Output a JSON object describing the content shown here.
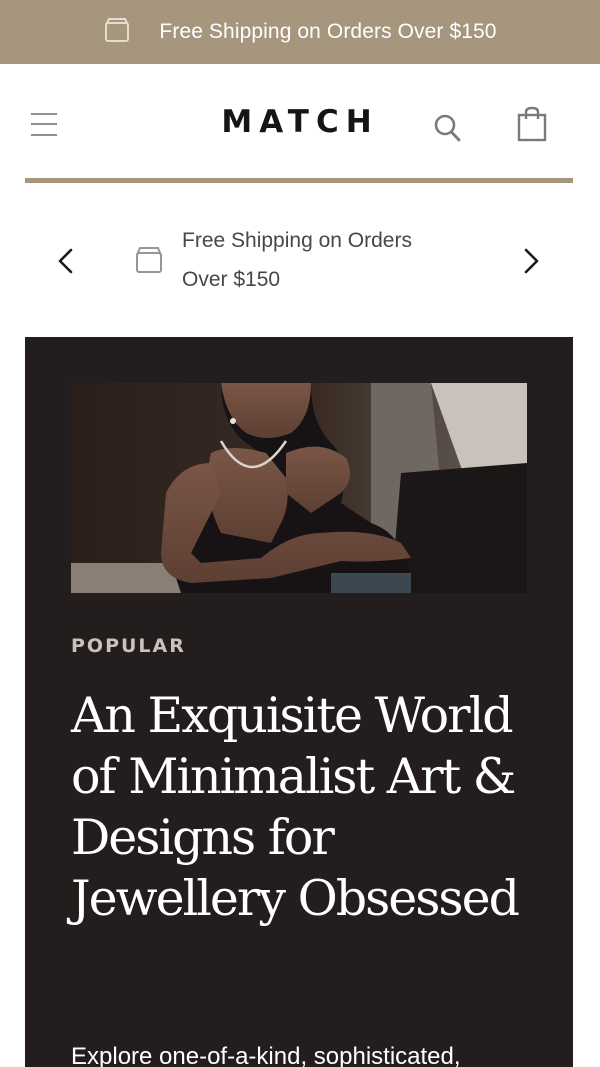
{
  "announcement": {
    "text": "Free Shipping on Orders Over $150",
    "icon": "box-icon"
  },
  "header": {
    "logo": "MATCH",
    "menu_icon": "hamburger-icon",
    "search_icon": "search-icon",
    "cart_icon": "shopping-bag-icon"
  },
  "promo_slider": {
    "line1": "Free Shipping on Orders",
    "line2": "Over $150",
    "prev_icon": "chevron-left-icon",
    "next_icon": "chevron-right-icon"
  },
  "hero": {
    "eyebrow": "POPULAR",
    "title": "An Exquisite World of Minimalist Art & Designs for Jewellery Obsessed",
    "body": "Explore one-of-a-kind, sophisticated,"
  },
  "colors": {
    "accent": "#a6967d",
    "hero_bg": "#231e1d",
    "text_dark": "#161414"
  }
}
